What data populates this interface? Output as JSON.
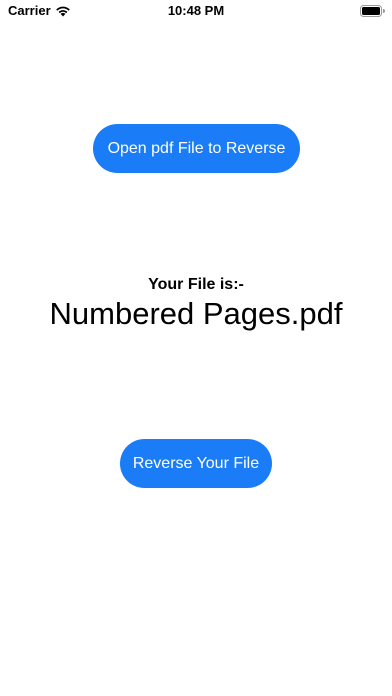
{
  "status_bar": {
    "carrier": "Carrier",
    "time": "10:48 PM",
    "icons": [
      "wifi-icon",
      "battery-icon"
    ]
  },
  "main": {
    "open_button_label": "Open pdf File to Reverse",
    "file_label": "Your File is:-",
    "file_name": "Numbered Pages.pdf",
    "reverse_button_label": "Reverse Your File"
  },
  "colors": {
    "accent": "#1a7cf6",
    "background": "#ffffff",
    "text": "#000000"
  }
}
